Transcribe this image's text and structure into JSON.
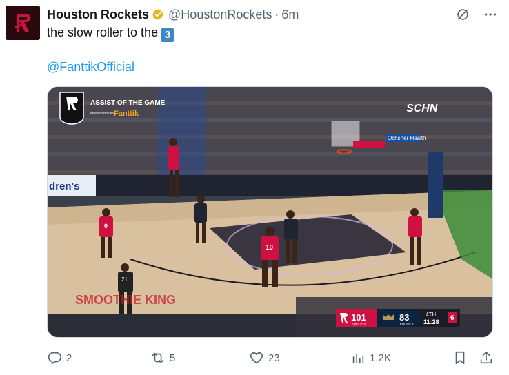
{
  "tweet": {
    "author_name": "Houston Rockets",
    "handle": "@HoustonRockets",
    "separator": "·",
    "time": "6m",
    "text_line1": "the slow roller to the",
    "emoji_3": "3",
    "mention": "@FanttikOfficial"
  },
  "media": {
    "overlay_title": "ASSIST OF THE GAME",
    "overlay_presented": "PRESENTED BY",
    "overlay_sponsor": "Fanttik",
    "scoreboard": {
      "home_score": "101",
      "home_fouls": "FOULS: 0",
      "away_score": "83",
      "away_fouls": "FOULS: 1",
      "quarter": "4TH",
      "clock": "11:28",
      "shot_clock": "6"
    },
    "court_text_left": "dren's",
    "court_text_bottom": "SMOOTHIE KING",
    "ad_board": "Ochsner Health",
    "network_logo": "SCHN",
    "jersey_0": "0",
    "jersey_10": "10",
    "jersey_21": "21"
  },
  "actions": {
    "replies": "2",
    "reposts": "5",
    "likes": "23",
    "views": "1.2K"
  },
  "colors": {
    "accent": "#1d9bf0",
    "muted": "#536471",
    "rockets_red": "#ce1141",
    "verified_gold": "#e2b719"
  },
  "icons": {
    "verified": "gold-verified-badge-icon",
    "grok": "grok-icon",
    "more": "more-icon",
    "reply": "reply-icon",
    "repost": "repost-icon",
    "like": "heart-icon",
    "views": "views-icon",
    "bookmark": "bookmark-icon",
    "share": "share-icon"
  }
}
